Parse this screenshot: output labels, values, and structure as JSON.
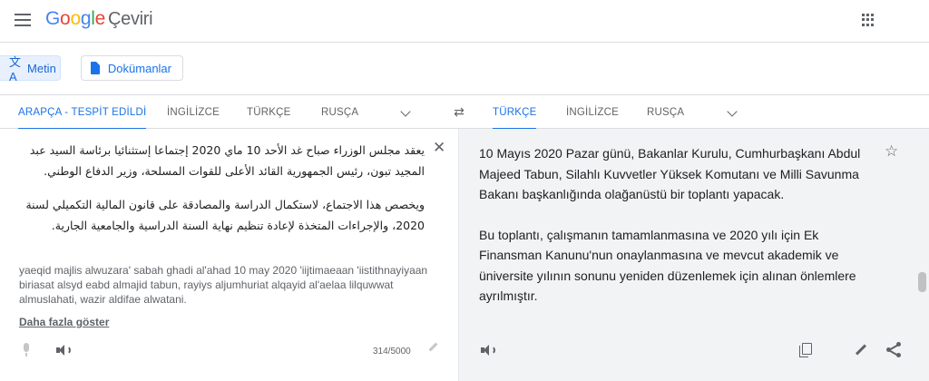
{
  "header": {
    "logo_letters": [
      "G",
      "o",
      "o",
      "g",
      "l",
      "e"
    ],
    "product_name": "Çeviri",
    "icons": {
      "menu": "hamburger-menu-icon",
      "apps": "google-apps-icon"
    }
  },
  "modes": {
    "text_label": "Metin",
    "documents_label": "Dokümanlar",
    "text_icon": "translate-icon",
    "documents_icon": "document-icon"
  },
  "source_languages": {
    "detected": "ARAPÇA - TESPİT EDİLDİ",
    "options": [
      "İNGİLİZCE",
      "TÜRKÇE",
      "RUSÇA"
    ]
  },
  "target_languages": {
    "options": [
      "TÜRKÇE",
      "İNGİLİZCE",
      "RUSÇA"
    ]
  },
  "source": {
    "paragraphs": [
      "يعقد مجلس الوزراء صباح غد الأحد 10 ماي 2020 إجتماعا إستثنائيا برئاسة السيد عبد المجيد تبون، رئيس الجمهورية القائد الأعلى للقوات المسلحة، وزير الدفاع الوطني.",
      "ويخصص هذا الاجتماع، لاستكمال الدراسة والمصادقة على قانون المالية التكميلي لسنة 2020، والإجراءات المتخذة لإعادة تنظيم نهاية السنة الدراسية والجامعية الجارية."
    ],
    "transliteration": "yaeqid majlis alwuzara' sabah ghadi al'ahad 10 may 2020 'iijtimaeaan 'iistithnayiyaan biriasat alsyd eabd almajid tabun, rayiys aljumhuriat alqayid al'aelaa lilquwwat almuslahati, wazir aldifae alwatani.",
    "more_link": "Daha fazla göster",
    "char_count": "314/5000"
  },
  "target": {
    "paragraphs": [
      "10 Mayıs 2020 Pazar günü, Bakanlar Kurulu, Cumhurbaşkanı Abdul Majeed Tabun, Silahlı Kuvvetler Yüksek Komutanı ve Milli Savunma Bakanı başkanlığında olağanüstü bir toplantı yapacak.",
      "Bu toplantı, çalışmanın tamamlanmasına ve 2020 yılı için Ek Finansman Kanunu'nun onaylanmasına ve mevcut akademik ve üniversite yılının sonunu yeniden düzenlemek için alınan önlemlere ayrılmıştır."
    ]
  },
  "colors": {
    "accent": "#1a73e8",
    "accent_bg": "#e8f0fe",
    "panel_bg": "#f1f3f4",
    "muted": "#5f6368"
  }
}
